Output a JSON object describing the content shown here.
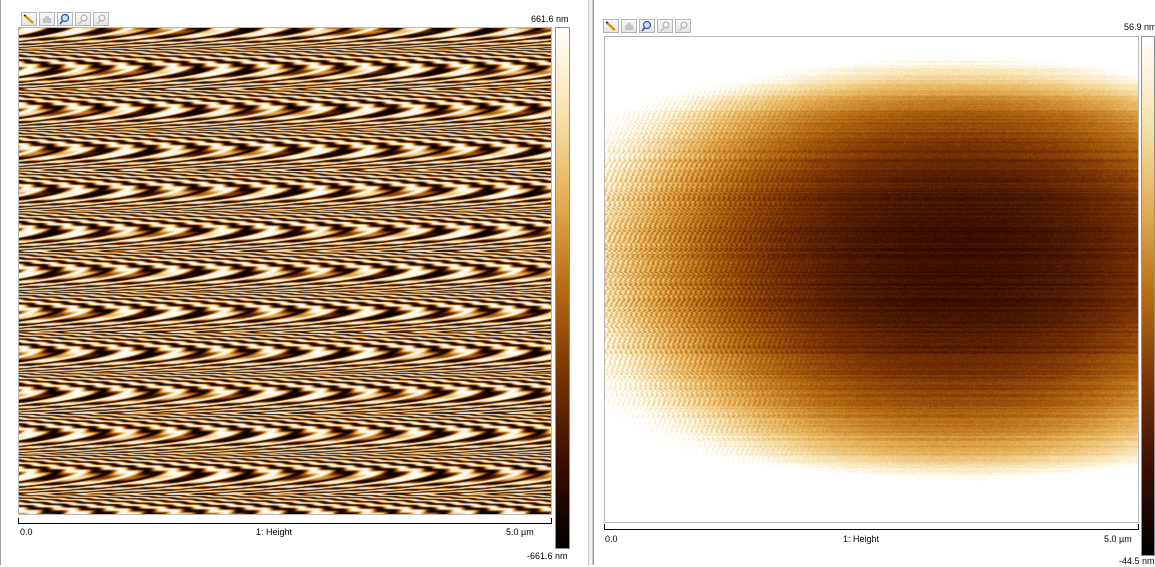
{
  "colormap": [
    "#000000",
    "#3a0e00",
    "#7a3304",
    "#b86b12",
    "#e4ad52",
    "#f7e2ad",
    "#ffffff"
  ],
  "toolbar_icons": [
    "pencil-icon",
    "hand-icon",
    "magnifier-icon",
    "zoom-in-icon",
    "zoom-out-icon"
  ],
  "panels": [
    {
      "id": "left",
      "channel_label": "1: Height",
      "x_start": "0.0",
      "x_end": "5.0 µm",
      "scale_max": "661.6 nm",
      "scale_min": "-661.6 nm",
      "pattern": "moire-fringes"
    },
    {
      "id": "right",
      "channel_label": "1: Height",
      "x_start": "0.0",
      "x_end": "5.0 µm",
      "scale_max": "56.9 nm",
      "scale_min": "-44.5 nm",
      "pattern": "noisy-surface"
    }
  ]
}
